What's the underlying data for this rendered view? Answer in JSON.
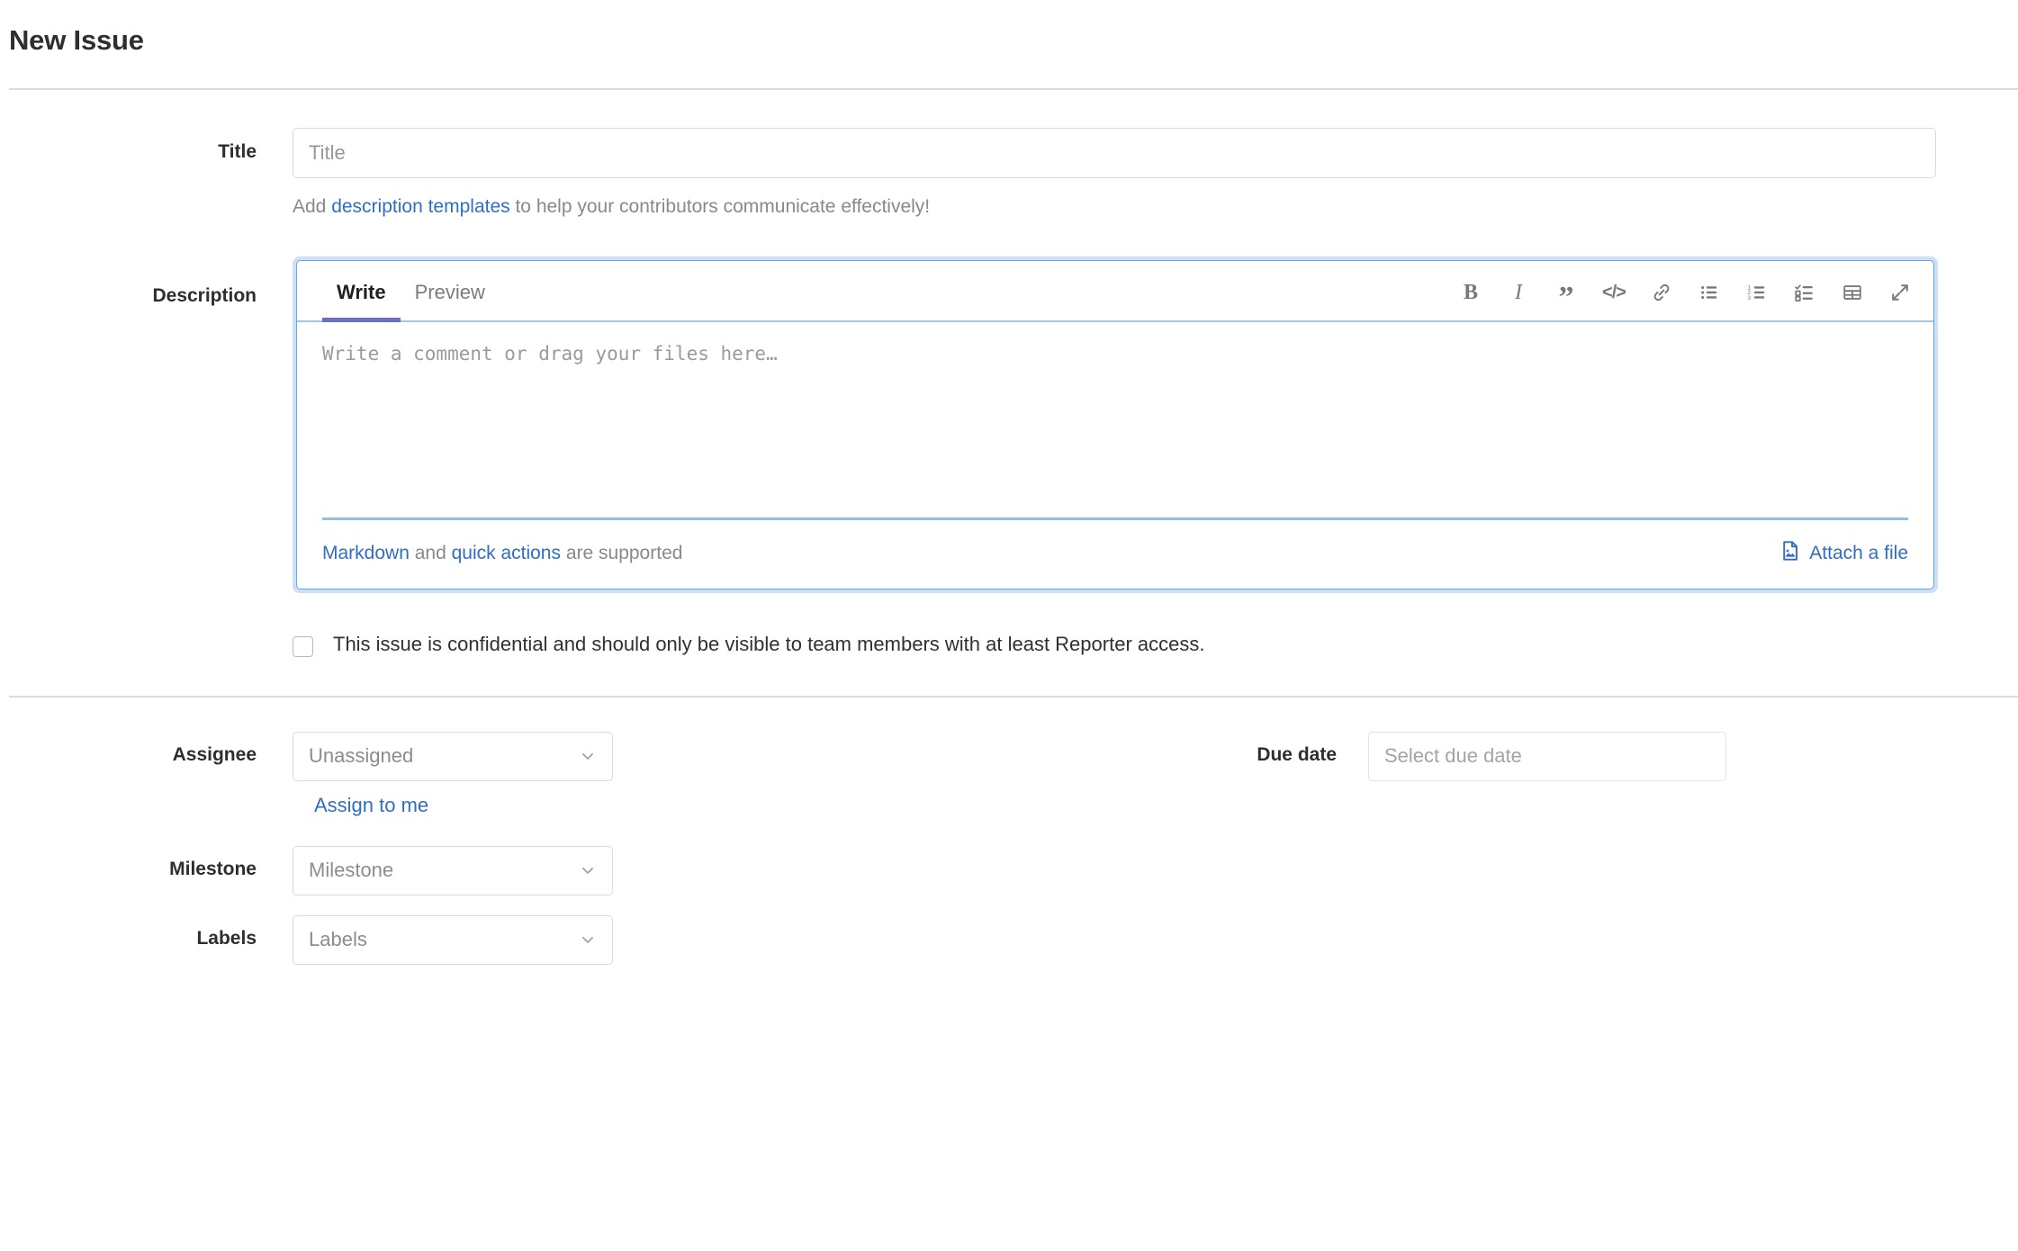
{
  "page": {
    "title": "New Issue"
  },
  "title_field": {
    "label": "Title",
    "value": "",
    "placeholder": "Title",
    "hint_prefix": "Add ",
    "hint_link": "description templates",
    "hint_suffix": " to help your contributors communicate effectively!"
  },
  "description": {
    "label": "Description",
    "tabs": [
      {
        "label": "Write",
        "active": true
      },
      {
        "label": "Preview",
        "active": false
      }
    ],
    "toolbar": [
      {
        "name": "bold-icon",
        "title": "Bold"
      },
      {
        "name": "italic-icon",
        "title": "Italic"
      },
      {
        "name": "quote-icon",
        "title": "Insert a quote"
      },
      {
        "name": "code-icon",
        "title": "Insert code"
      },
      {
        "name": "link-icon",
        "title": "Add a link"
      },
      {
        "name": "bullet-list-icon",
        "title": "Add a bullet list"
      },
      {
        "name": "numbered-list-icon",
        "title": "Add a numbered list"
      },
      {
        "name": "task-list-icon",
        "title": "Add a checklist"
      },
      {
        "name": "table-icon",
        "title": "Add a table"
      },
      {
        "name": "fullscreen-icon",
        "title": "Go full screen"
      }
    ],
    "textarea_value": "",
    "textarea_placeholder": "Write a comment or drag your files here…",
    "footer": {
      "markdown_link": "Markdown",
      "and_text": " and ",
      "quick_actions_link": "quick actions",
      "supported_text": " are supported",
      "attach_label": "Attach a file"
    }
  },
  "confidential": {
    "checked": false,
    "label": "This issue is confidential and should only be visible to team members with at least Reporter access."
  },
  "fields": {
    "assignee": {
      "label": "Assignee",
      "value": "Unassigned",
      "assign_to_me": "Assign to me"
    },
    "milestone": {
      "label": "Milestone",
      "value": "Milestone"
    },
    "labels": {
      "label": "Labels",
      "value": "Labels"
    },
    "due_date": {
      "label": "Due date",
      "value": "",
      "placeholder": "Select due date"
    }
  },
  "colors": {
    "link": "#2f6ec4",
    "focus_ring": "#cfe0f6",
    "focus_border": "#63a6e9",
    "active_tab_underline": "#6b6fc4",
    "divider": "#dcdcde",
    "text": "#303030",
    "muted": "#89888d"
  }
}
